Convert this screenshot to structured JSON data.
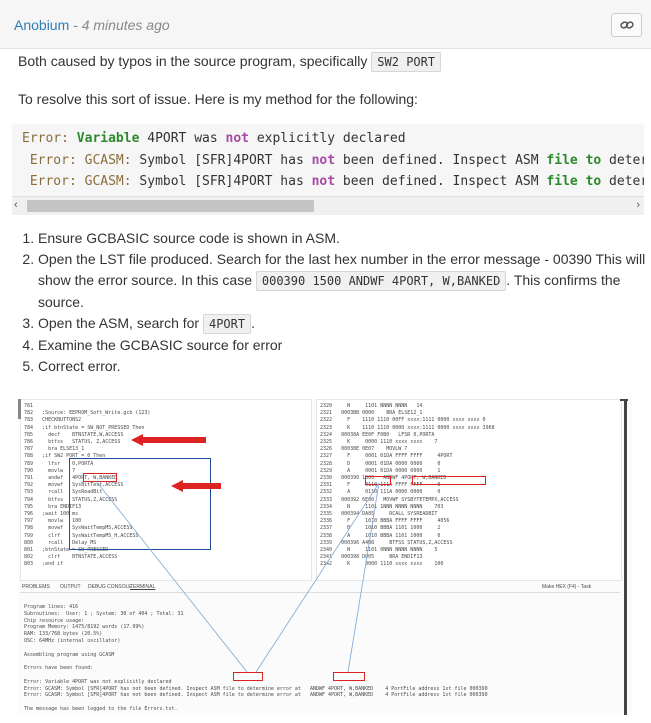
{
  "header": {
    "author": "Anobium",
    "separator": " - ",
    "time": "4 minutes ago",
    "link_icon": "link-icon"
  },
  "intro": {
    "text": "Both caused by typos in the source program, specifically ",
    "code": "SW2 PORT"
  },
  "method_text": "To resolve this sort of issue. Here is my method for the following:",
  "code_lines": [
    {
      "label": "Error:",
      "kw1": "Variable",
      "m1": " 4PORT was ",
      "not": "not",
      "m2": " explicitly declared",
      "kw2": "",
      "m3": "",
      "kw3": "",
      "m4": ""
    },
    {
      "label": " Error:",
      "g": " GCASM:",
      "m1": " Symbol [SFR]4PORT has ",
      "not": "not",
      "m2": " been defined. Inspect ASM ",
      "kw2": "file",
      "m3": " ",
      "kw3": "to",
      "m4": " determ"
    },
    {
      "label": " Error:",
      "g": " GCASM:",
      "m1": " Symbol [SFR]4PORT has ",
      "not": "not",
      "m2": " been defined. Inspect ASM ",
      "kw2": "file",
      "m3": " ",
      "kw3": "to",
      "m4": " determ"
    }
  ],
  "scroll": {
    "left": "‹",
    "right": "›"
  },
  "steps": {
    "s1": "Ensure GCBASIC source code is shown in ASM.",
    "s2a": "Open the LST file produced. Search for the last hex number in the error message - 00390 This will show the error source. In this case ",
    "s2code": "000390 1500 ANDWF 4PORT, W,BANKED",
    "s2b": ". This confirms the source.",
    "s3a": "Open the ASM, search for ",
    "s3code": "4PORT",
    "s3b": ".",
    "s4": "Examine the GCBASIC source for error",
    "s5": "Correct error."
  },
  "screenshot": {
    "left_lines": [
      "781",
      "782   ;Source: EEPROM_Soft_Write.gcb (123)",
      "783   CHECKBUTTONS2",
      "784   ;if btnState = SW_NOT_PRESSED Then",
      "785     decf    BTNSTATE,W,ACCESS",
      "786     btfss   STATUS, Z,ACCESS",
      "787     bra ELSE13_1",
      "788   ;if SW2 PORT = 0 Then",
      "789     lfsr    0,PORTA",
      "790     movlw   7",
      "791     andwf   4PORT, W,BANKED",
      "792     movwf   SysBitTest,ACCESS",
      "793     rcall   SysReadBit",
      "794     btfss   STATUS,Z,ACCESS",
      "795     bra ENDIF13",
      "796   ;wait 100 ms",
      "797     movlw   100",
      "798     movwf   SysWaitTempMS,ACCESS",
      "799     clrf    SysWaitTempMS_H,ACCESS",
      "800     rcall   Delay_MS",
      "801   ;btnState = SW_PRESSED",
      "802     clrf    BTNSTATE,ACCESS",
      "803   ;end if"
    ],
    "right_lines": [
      "2320     N     1101 NNNN NNNN   14",
      "2321   0003BB 0000    BRA ELSE12_1",
      "2322     F    1110 1110 00FF xxxx:1111 0000 xxxx xxxx 0",
      "2323     K    1110 1110 0000 xxxx:1111 0000 xxxx xxxx 3968",
      "2324   00038A EE0F F0B0   LFSR 0,PORTA",
      "2325     K     0000 1110 xxxx xxxx    7",
      "2326   00038E 0E07    MOVLW 7",
      "2327     F     0001 01DA FFFF FFFF     4PORT",
      "2328     D     0001 01DA 0000 0000     0",
      "2329     A     0001 01DA 0000 0000     1",
      "2330   000390 1500   ANDWF 4PORT, W,BANKED",
      "2331     F     0110 111A FFFF FFFF     0",
      "2332     A     0110 111A 0000 0000     0",
      "2333   000392 6E00   MOVWF SYSBYTETEMPX,ACCESS",
      "2334     N     1101 1NNN NNNN NNNN    703",
      "2335   000394 DA85     RCALL SYSREADBIT",
      "2336     F     1010 BBBA FFFF FFFF     4056",
      "2337     B     1010 BBBA 1101 1000     2",
      "2338     A     1010 BBBA 1101 1000     0",
      "2339   000396 A4D8     BTFSS STATUS,Z,ACCESS",
      "2340     N     1101 0NNN NNNN NNNN    5",
      "2341   000398 D005     BRA ENDIF13",
      "2342     K     0000 1110 xxxx xxxx    100"
    ],
    "panel_tabs": [
      "PROBLEMS",
      "OUTPUT",
      "DEBUG CONSOLE",
      "TERMINAL"
    ],
    "panel_right": "Make HEX (F4) - Task",
    "terminal_lines": [
      "Program lines: 416",
      "Subroutines:  User: 1 ; System: 30 of 404 ; Total: 31",
      "Chip resource usage:",
      "Program Memory: 1475/8192 words (17.99%)",
      "RAM: 133/768 bytes (20.5%)",
      "OSC: 64MHz (internal oscillator)",
      "",
      "Assembling program using GCASM",
      "",
      "Errors have been found:",
      "",
      "Error: Variable 4PORT was not explicitly declared",
      "Error: GCASM: Symbol [SFR]4PORT has not been defined. Inspect ASM file to determine error at   ANDWF 4PORT, W,BANKED    4 PortFile address 1st file 000390",
      "Error: GCASM: Symbol [SFR]4PORT has not been defined. Inspect ASM file to determine error at   ANDWF 4PORT, W,BANKED    4 PortFile address 1st file 000390",
      "",
      "The message has been logged to the file Errors.txt."
    ]
  }
}
